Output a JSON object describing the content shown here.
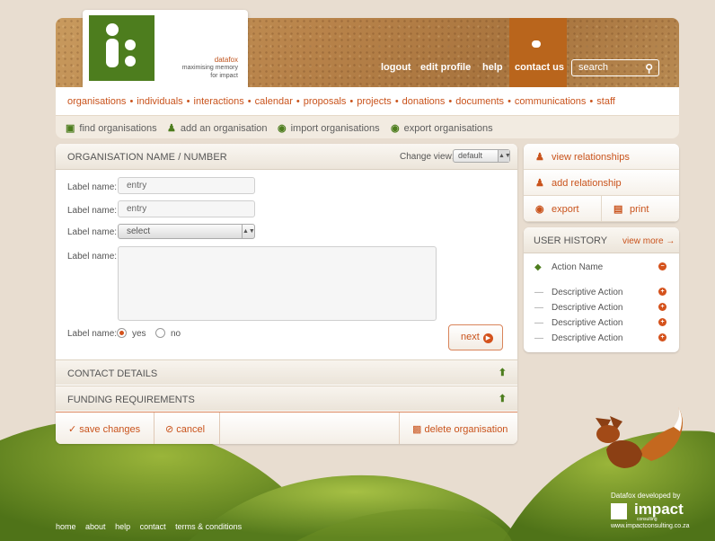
{
  "colors": {
    "accent": "#c9531c",
    "green": "#4d7d1e",
    "header": "#b8834a"
  },
  "brand": {
    "name": "datafox",
    "tagline1": "maximising memory",
    "tagline2": "for impact"
  },
  "topnav": {
    "logout": "logout",
    "edit_profile": "edit profile",
    "help": "help",
    "contact_us": "contact us",
    "search_placeholder": "search"
  },
  "menu": [
    "organisations",
    "individuals",
    "interactions",
    "calendar",
    "proposals",
    "projects",
    "donations",
    "documents",
    "communications",
    "staff"
  ],
  "submenu": {
    "find": "find organisations",
    "add": "add an organisation",
    "import": "import organisations",
    "export": "export organisations"
  },
  "panel": {
    "title": "ORGANISATION NAME / NUMBER",
    "change_view_label": "Change view:",
    "view_value": "default",
    "label": "Label name:",
    "field1": "entry",
    "field2": "entry",
    "select_value": "select",
    "radio_yes": "yes",
    "radio_no": "no",
    "next": "next"
  },
  "sections": {
    "contact": "CONTACT DETAILS",
    "funding": "FUNDING REQUIREMENTS"
  },
  "footer_actions": {
    "save": "save changes",
    "cancel": "cancel",
    "delete": "delete organisation"
  },
  "side": {
    "view_relationships": "view relationships",
    "add_relationship": "add relationship",
    "export": "export",
    "print": "print"
  },
  "history": {
    "title": "USER HISTORY",
    "view_more": "view more",
    "header_item": "Action Name",
    "items": [
      "Descriptive Action",
      "Descriptive Action",
      "Descriptive Action",
      "Descriptive Action"
    ]
  },
  "footer": {
    "home": "home",
    "about": "about",
    "help": "help",
    "contact": "contact",
    "terms": "terms & conditions"
  },
  "credit": {
    "line1": "Datafox developed by",
    "company": "impact",
    "sub": "consulting",
    "url": "www.impactconsulting.co.za"
  }
}
